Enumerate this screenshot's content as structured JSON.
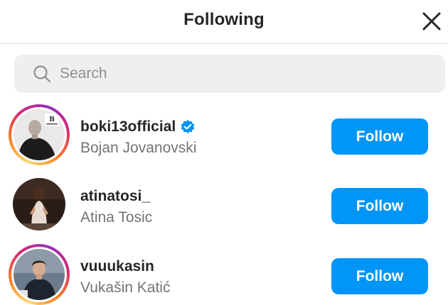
{
  "header": {
    "title": "Following",
    "close_icon": "close-icon"
  },
  "search": {
    "placeholder": "Search",
    "value": "",
    "icon": "search-icon"
  },
  "accounts": [
    {
      "username": "boki13official",
      "full_name": "Bojan Jovanovski",
      "verified": true,
      "has_story_ring": true,
      "follow_label": "Follow"
    },
    {
      "username": "atinatosi_",
      "full_name": "Atina Tosic",
      "verified": false,
      "has_story_ring": false,
      "follow_label": "Follow"
    },
    {
      "username": "vuuukasin",
      "full_name": "Vukašin Katić",
      "verified": false,
      "has_story_ring": true,
      "follow_label": "Follow"
    }
  ],
  "colors": {
    "follow_button": "#0095f6",
    "verified_badge": "#0095f6",
    "search_background": "#efefef",
    "secondary_text": "#737373"
  }
}
